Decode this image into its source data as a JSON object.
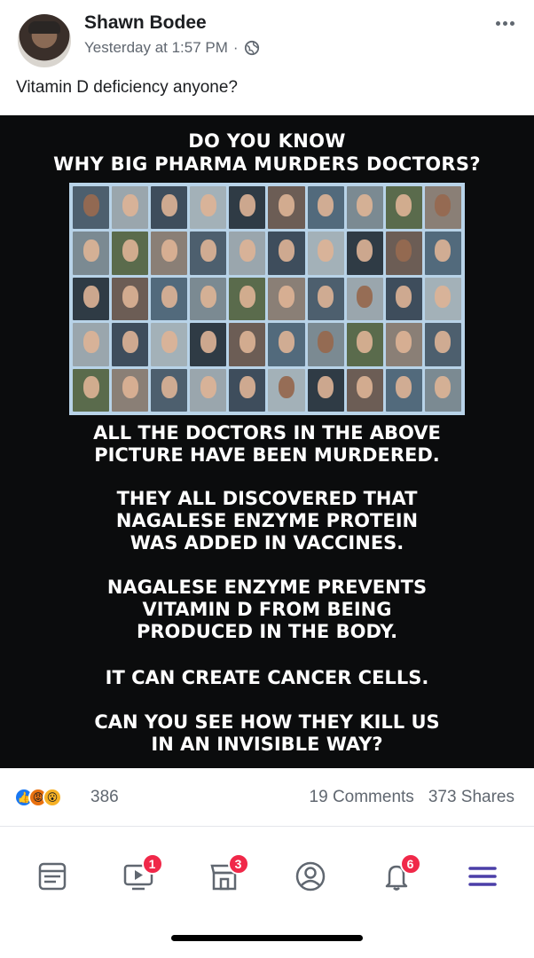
{
  "post": {
    "author": "Shawn Bodee",
    "timestamp": "Yesterday at 1:57 PM",
    "separator": "·",
    "privacy_icon": "globe-icon",
    "more_icon": "more-horizontal-icon",
    "caption": "Vitamin D deficiency anyone?"
  },
  "meme": {
    "headline_1": "DO YOU KNOW",
    "headline_2": "WHY BIG PHARMA MURDERS DOCTORS?",
    "photo_grid_rows": 5,
    "photo_grid_cols": 10,
    "lines": [
      [
        "ALL THE DOCTORS IN THE ABOVE",
        "PICTURE HAVE BEEN MURDERED."
      ],
      [
        "THEY ALL DISCOVERED THAT",
        "NAGALESE ENZYME PROTEIN",
        "WAS ADDED IN VACCINES."
      ],
      [
        "NAGALESE ENZYME PREVENTS",
        "VITAMIN D FROM BEING",
        "PRODUCED IN THE BODY."
      ],
      [
        "IT CAN CREATE CANCER CELLS."
      ],
      [
        "CAN YOU SEE HOW THEY KILL US",
        "IN AN INVISIBLE WAY?"
      ]
    ]
  },
  "engagement": {
    "reaction_icons": [
      "like-icon",
      "angry-icon",
      "wow-icon"
    ],
    "reaction_count": "386",
    "comments": "19 Comments",
    "shares": "373 Shares"
  },
  "tabbar": {
    "tabs": [
      {
        "name": "news-feed-tab",
        "icon": "newsfeed-icon",
        "badge": ""
      },
      {
        "name": "watch-tab",
        "icon": "watch-icon",
        "badge": "1"
      },
      {
        "name": "marketplace-tab",
        "icon": "marketplace-icon",
        "badge": "3"
      },
      {
        "name": "profile-tab",
        "icon": "profile-icon",
        "badge": ""
      },
      {
        "name": "notifications-tab",
        "icon": "bell-icon",
        "badge": "6"
      },
      {
        "name": "menu-tab",
        "icon": "hamburger-menu-icon",
        "badge": ""
      }
    ]
  },
  "colors": {
    "brand": "#1877f2",
    "badge": "#f02849",
    "meme_background": "#0b0c0d"
  }
}
